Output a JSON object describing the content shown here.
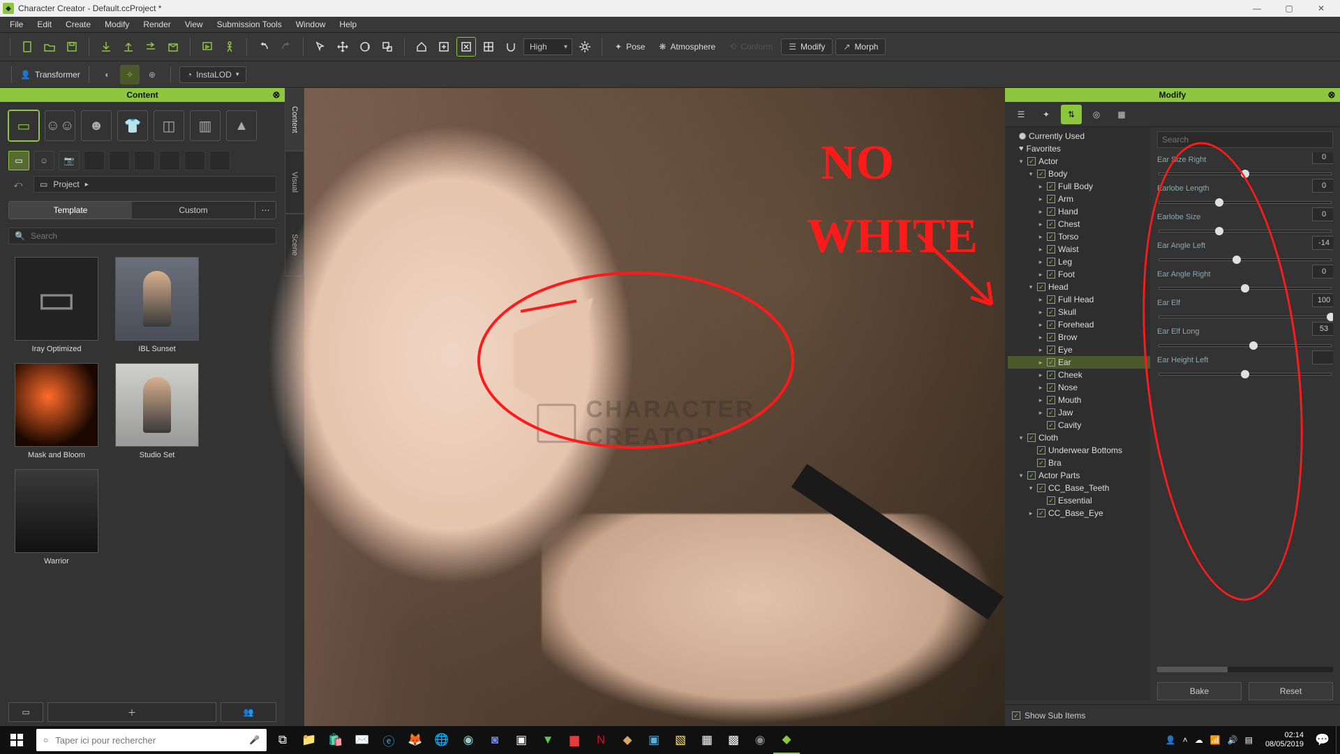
{
  "window": {
    "title": "Character Creator - Default.ccProject *"
  },
  "menus": [
    "File",
    "Edit",
    "Create",
    "Modify",
    "Render",
    "View",
    "Submission Tools",
    "Window",
    "Help"
  ],
  "toolbar": {
    "quality": "High",
    "modes": {
      "pose": "Pose",
      "atmosphere": "Atmosphere",
      "conform": "Conform",
      "modify": "Modify",
      "morph": "Morph"
    }
  },
  "subtoolbar": {
    "transformer": "Transformer",
    "instalod": "InstaLOD"
  },
  "content_panel": {
    "title": "Content",
    "breadcrumb": "Project",
    "tabs": {
      "template": "Template",
      "custom": "Custom"
    },
    "search_placeholder": "Search",
    "thumbs": [
      {
        "label": "Iray Optimized",
        "kind": "folder"
      },
      {
        "label": "IBL Sunset",
        "kind": "sunset"
      },
      {
        "label": "Mask and Bloom",
        "kind": "bloom"
      },
      {
        "label": "Studio Set",
        "kind": "studio"
      },
      {
        "label": "Warrior",
        "kind": "warrior"
      }
    ]
  },
  "sidetabs": [
    "Content",
    "Visual",
    "Scene"
  ],
  "viewport": {
    "watermark1": "CHARACTER",
    "watermark2": "CREATOR"
  },
  "modify_panel": {
    "title": "Modify",
    "filters": {
      "currently_used": "Currently Used",
      "favorites": "Favorites"
    },
    "search_placeholder": "Search",
    "tree": [
      {
        "lvl": 1,
        "arrow": "▾",
        "chk": true,
        "label": "Actor"
      },
      {
        "lvl": 2,
        "arrow": "▾",
        "chk": true,
        "label": "Body"
      },
      {
        "lvl": 3,
        "arrow": "▸",
        "chk": true,
        "label": "Full Body"
      },
      {
        "lvl": 3,
        "arrow": "▸",
        "chk": true,
        "label": "Arm"
      },
      {
        "lvl": 3,
        "arrow": "▸",
        "chk": true,
        "label": "Hand"
      },
      {
        "lvl": 3,
        "arrow": "▸",
        "chk": true,
        "label": "Chest"
      },
      {
        "lvl": 3,
        "arrow": "▸",
        "chk": true,
        "label": "Torso"
      },
      {
        "lvl": 3,
        "arrow": "▸",
        "chk": true,
        "label": "Waist"
      },
      {
        "lvl": 3,
        "arrow": "▸",
        "chk": true,
        "label": "Leg"
      },
      {
        "lvl": 3,
        "arrow": "▸",
        "chk": true,
        "label": "Foot"
      },
      {
        "lvl": 2,
        "arrow": "▾",
        "chk": true,
        "label": "Head"
      },
      {
        "lvl": 3,
        "arrow": "▸",
        "chk": true,
        "label": "Full Head"
      },
      {
        "lvl": 3,
        "arrow": "▸",
        "chk": true,
        "label": "Skull"
      },
      {
        "lvl": 3,
        "arrow": "▸",
        "chk": true,
        "label": "Forehead"
      },
      {
        "lvl": 3,
        "arrow": "▸",
        "chk": true,
        "label": "Brow"
      },
      {
        "lvl": 3,
        "arrow": "▸",
        "chk": true,
        "label": "Eye"
      },
      {
        "lvl": 3,
        "arrow": "▸",
        "chk": true,
        "label": "Ear",
        "sel": true
      },
      {
        "lvl": 3,
        "arrow": "▸",
        "chk": true,
        "label": "Cheek"
      },
      {
        "lvl": 3,
        "arrow": "▸",
        "chk": true,
        "label": "Nose"
      },
      {
        "lvl": 3,
        "arrow": "▸",
        "chk": true,
        "label": "Mouth"
      },
      {
        "lvl": 3,
        "arrow": "▸",
        "chk": true,
        "label": "Jaw"
      },
      {
        "lvl": 3,
        "arrow": "",
        "chk": true,
        "label": "Cavity"
      },
      {
        "lvl": 1,
        "arrow": "▾",
        "chk": true,
        "label": "Cloth"
      },
      {
        "lvl": 2,
        "arrow": "",
        "chk": true,
        "label": "Underwear Bottoms"
      },
      {
        "lvl": 2,
        "arrow": "",
        "chk": true,
        "label": "Bra"
      },
      {
        "lvl": 1,
        "arrow": "▾",
        "chk": true,
        "label": "Actor Parts"
      },
      {
        "lvl": 2,
        "arrow": "▾",
        "chk": true,
        "label": "CC_Base_Teeth"
      },
      {
        "lvl": 3,
        "arrow": "",
        "chk": true,
        "label": "Essential"
      },
      {
        "lvl": 2,
        "arrow": "▸",
        "chk": true,
        "label": "CC_Base_Eye"
      }
    ],
    "sliders": [
      {
        "name": "Ear Size Right",
        "val": "0",
        "pos": 50
      },
      {
        "name": "Earlobe Length",
        "val": "0",
        "pos": 35
      },
      {
        "name": "Earlobe Size",
        "val": "0",
        "pos": 35
      },
      {
        "name": "Ear Angle Left",
        "val": "-14",
        "pos": 45
      },
      {
        "name": "Ear Angle Right",
        "val": "0",
        "pos": 50
      },
      {
        "name": "Ear Elf",
        "val": "100",
        "pos": 100
      },
      {
        "name": "Ear Elf Long",
        "val": "53",
        "pos": 55
      },
      {
        "name": "Ear Height Left",
        "val": "",
        "pos": 50
      }
    ],
    "bake": "Bake",
    "reset": "Reset",
    "showsub": "Show Sub Items"
  },
  "annotation": {
    "line1": "NO",
    "line2": "WHITE"
  },
  "taskbar": {
    "search_placeholder": "Taper ici pour rechercher",
    "time": "02:14",
    "date": "08/05/2019"
  }
}
